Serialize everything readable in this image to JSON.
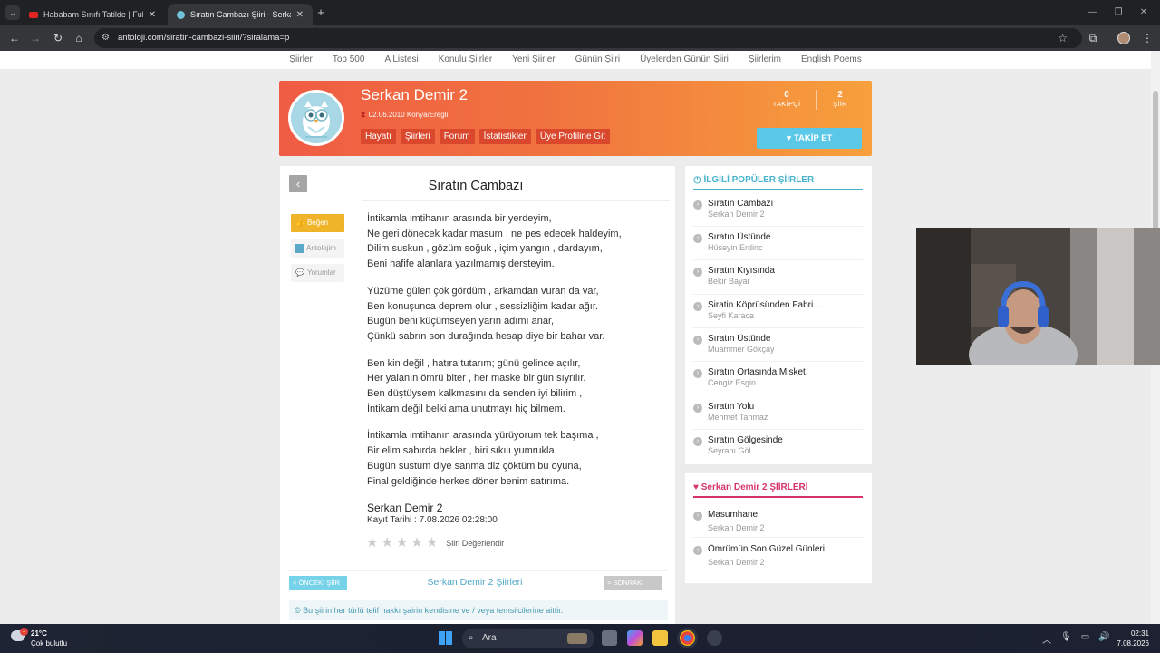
{
  "browser": {
    "tabs": [
      {
        "title": "Hababam Sınıfı Tatilde | Full HD",
        "close": "✕"
      },
      {
        "title": "Sıratın Cambazı Şiiri - Serkan De",
        "close": "✕"
      }
    ],
    "new_tab": "+",
    "url": "antoloji.com/siratin-cambazi-siiri/?siralama=p"
  },
  "topnav": [
    "Şiirler",
    "Top 500",
    "A Listesi",
    "Konulu Şiirler",
    "Yeni Şiirler",
    "Günün Şiiri",
    "Üyelerden Günün Şiiri",
    "Şiirlerim",
    "English Poems"
  ],
  "profile": {
    "name": "Serkan Demir 2",
    "meta": "02.06.2010 Konya/Ereğli",
    "tabs": [
      "Hayatı",
      "Şiirleri",
      "Forum",
      "İstatistikler",
      "Üye Profiline Git"
    ],
    "followers_count": "0",
    "followers_label": "TAKİPÇİ",
    "poems_count": "2",
    "poems_label": "ŞİİR",
    "follow_label": "TAKİP ET"
  },
  "poem": {
    "title": "Sıratın Cambazı",
    "actions": {
      "like": "Beğen",
      "anthology": "Antolojim",
      "comments": "Yorumlar"
    },
    "stanzas": [
      [
        "İntikamla imtihanın arasında bir yerdeyim,",
        "Ne geri dönecek kadar masum , ne pes edecek haldeyim,",
        "Dilim suskun , gözüm soğuk , içim yangın , dardayım,",
        "Beni hafife alanlara yazılmamış dersteyim."
      ],
      [
        "Yüzüme gülen çok gördüm , arkamdan vuran da var,",
        "Ben konuşunca deprem olur , sessizliğim kadar ağır.",
        "Bugün beni küçümseyen yarın adımı anar,",
        "Çünkü sabrın son durağında hesap diye bir bahar var."
      ],
      [
        "Ben kin değil , hatıra tutarım; günü gelince açılır,",
        "Her yalanın ömrü biter , her maske bir gün sıyrılır.",
        "Ben düştüysem kalkmasını da senden iyi bilirim ,",
        "İntikam değil belki ama unutmayı hiç bilmem."
      ],
      [
        "İntikamla imtihanın arasında yürüyorum tek başıma ,",
        "Bir elim sabırda bekler , biri sıkılı yumrukla.",
        "Bugün sustum diye sanma diz çöktüm bu oyuna,",
        "Final geldiğinde herkes döner benim satırıma."
      ]
    ],
    "author": "Serkan Demir 2",
    "record": "Kayıt Tarihi : 7.08.2026 02:28:00",
    "rate_label": "Şiiri Değerlendir",
    "rating": 0,
    "max_rating": 5,
    "prev": "< ÖNCEKİ ŞİİR",
    "next": "> SONRAKİ",
    "all_poems": "Serkan Demir 2 Şiirleri",
    "copyright": "© Bu şiirin her türlü telif hakkı şairin kendisine ve / veya temsilcilerine aittir."
  },
  "popular": {
    "heading": "İLGİLİ POPÜLER ŞİİRLER",
    "items": [
      {
        "title": "Sıratın Cambazı",
        "author": "Serkan Demir 2"
      },
      {
        "title": "Sıratın Üstünde",
        "author": "Hüseyin Erdinc"
      },
      {
        "title": "Sıratın Kıyısında",
        "author": "Bekir Bayar"
      },
      {
        "title": "Siratin Köprüsünden Fabri ...",
        "author": "Seyfi Karaca"
      },
      {
        "title": "Sıratın Üstünde",
        "author": "Muammer Gökçay"
      },
      {
        "title": "Sıratın Ortasında Misket.",
        "author": "Cengiz Esgin"
      },
      {
        "title": "Sıratın Yolu",
        "author": "Mehmet Tahmaz"
      },
      {
        "title": "Sıratın Gölgesinde",
        "author": "Seyranı Göl"
      }
    ]
  },
  "poet_poems": {
    "heading": "Serkan Demir 2 ŞİİRLERİ",
    "items": [
      {
        "title": "Masumhane",
        "author": "Serkan Demir 2"
      },
      {
        "title": "Ömrümün Son Güzel Günleri",
        "author": "Serkan Demir 2"
      }
    ]
  },
  "taskbar": {
    "temp": "21°C",
    "weather": "Çok bulutlu",
    "weather_badge": "1",
    "search": "Ara",
    "time": "02:31",
    "date": "7.08.2026"
  },
  "colors": {
    "banner_start": "#ef5c44",
    "banner_end": "#f7a03c",
    "accent_blue": "#48b4cc",
    "accent_pink": "#d6336c",
    "like_yellow": "#f0b429"
  }
}
